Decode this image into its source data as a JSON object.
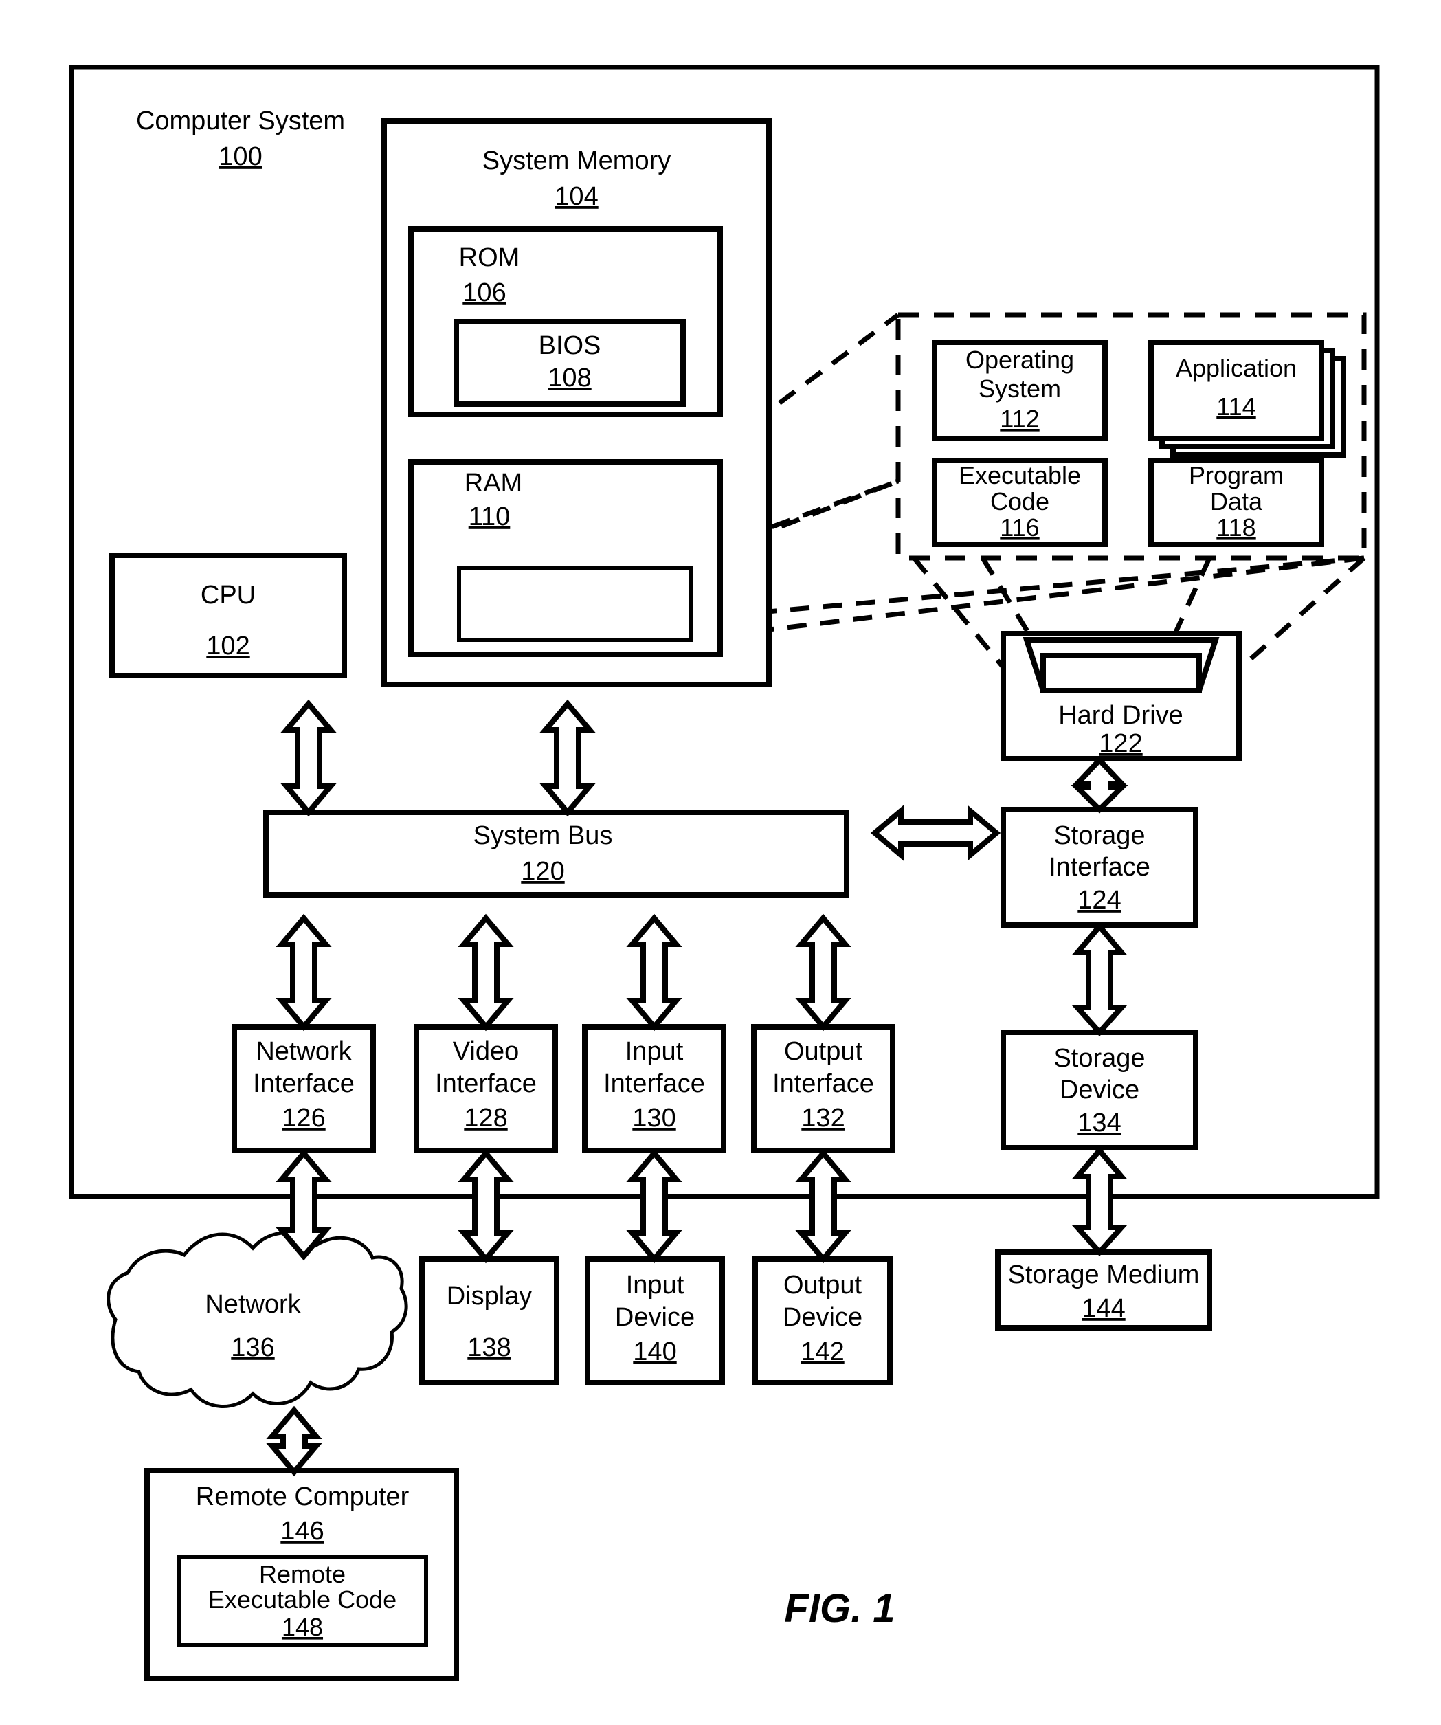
{
  "figure": {
    "caption": "FIG. 1",
    "outer": {
      "title": "Computer System",
      "number": "100"
    }
  },
  "blocks": {
    "cpu": {
      "label": "CPU",
      "number": "102"
    },
    "system_memory": {
      "label": "System Memory",
      "number": "104"
    },
    "rom": {
      "label": "ROM",
      "number": "106"
    },
    "bios": {
      "label": "BIOS",
      "number": "108"
    },
    "ram": {
      "label": "RAM",
      "number": "110"
    },
    "operating_system": {
      "label_line1": "Operating",
      "label_line2": "System",
      "number": "112"
    },
    "application": {
      "label": "Application",
      "number": "114"
    },
    "executable_code": {
      "label_line1": "Executable",
      "label_line2": "Code",
      "number": "116"
    },
    "program_data": {
      "label_line1": "Program",
      "label_line2": "Data",
      "number": "118"
    },
    "system_bus": {
      "label": "System Bus",
      "number": "120"
    },
    "hard_drive": {
      "label": "Hard Drive",
      "number": "122"
    },
    "storage_interface": {
      "label_line1": "Storage",
      "label_line2": "Interface",
      "number": "124"
    },
    "network_interface": {
      "label_line1": "Network",
      "label_line2": "Interface",
      "number": "126"
    },
    "video_interface": {
      "label_line1": "Video",
      "label_line2": "Interface",
      "number": "128"
    },
    "input_interface": {
      "label_line1": "Input",
      "label_line2": "Interface",
      "number": "130"
    },
    "output_interface": {
      "label_line1": "Output",
      "label_line2": "Interface",
      "number": "132"
    },
    "storage_device": {
      "label_line1": "Storage",
      "label_line2": "Device",
      "number": "134"
    },
    "network": {
      "label": "Network",
      "number": "136"
    },
    "display": {
      "label": "Display",
      "number": "138"
    },
    "input_device": {
      "label_line1": "Input",
      "label_line2": "Device",
      "number": "140"
    },
    "output_device": {
      "label_line1": "Output",
      "label_line2": "Device",
      "number": "142"
    },
    "storage_medium": {
      "label": "Storage Medium",
      "number": "144"
    },
    "remote_computer": {
      "label": "Remote Computer",
      "number": "146"
    },
    "remote_executable_code": {
      "label_line1": "Remote",
      "label_line2": "Executable Code",
      "number": "148"
    }
  },
  "colors": {
    "line": "#000000",
    "fill": "#ffffff"
  }
}
